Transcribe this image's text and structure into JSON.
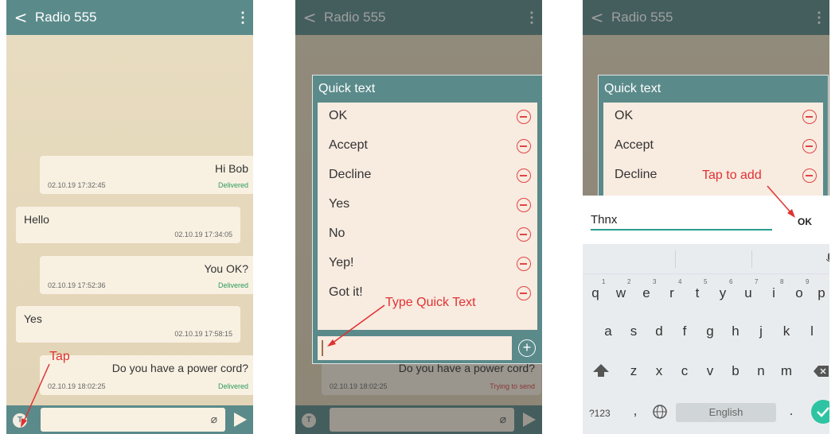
{
  "header": {
    "back": "<",
    "title": "Radio 555",
    "menu": "⋮"
  },
  "bar": {
    "qt_icon": "T",
    "clip": "⌀"
  },
  "messages": [
    {
      "dir": "out",
      "text": "Hi Bob",
      "time": "02.10.19 17:32:45",
      "status": "Delivered"
    },
    {
      "dir": "in",
      "text": "Hello",
      "time": "02.10.19 17:34:05",
      "status": ""
    },
    {
      "dir": "out",
      "text": "You OK?",
      "time": "02.10.19 17:52:36",
      "status": "Delivered"
    },
    {
      "dir": "in",
      "text": "Yes",
      "time": "02.10.19 17:58:15",
      "status": ""
    },
    {
      "dir": "out",
      "text": "Do you have a power cord?",
      "time": "02.10.19 18:02:25",
      "status": "Delivered"
    }
  ],
  "panel2": {
    "msg_text": "Do you have a power cord?",
    "msg_time": "02.10.19 18:02:25",
    "msg_status": "Trying to send"
  },
  "quick": {
    "title": "Quick text",
    "items": [
      "OK",
      "Accept",
      "Decline",
      "Yes",
      "No",
      "Yep!",
      "Got it!"
    ],
    "plus": "+"
  },
  "annotations": {
    "tap": "Tap",
    "type_quick": "Type Quick Text",
    "tap_add": "Tap to add"
  },
  "add": {
    "text": "Thnx",
    "ok": "OK"
  },
  "keyboard": {
    "row1": [
      "q",
      "w",
      "e",
      "r",
      "t",
      "y",
      "u",
      "i",
      "o",
      "p"
    ],
    "nums": [
      "1",
      "2",
      "3",
      "4",
      "5",
      "6",
      "7",
      "8",
      "9",
      "0"
    ],
    "row2": [
      "a",
      "s",
      "d",
      "f",
      "g",
      "h",
      "j",
      "k",
      "l"
    ],
    "row3": [
      "z",
      "x",
      "c",
      "v",
      "b",
      "n",
      "m"
    ],
    "mode": "?123",
    "comma": ",",
    "space": "English",
    "period": "."
  },
  "colors": {
    "accent": "#5b8a8a",
    "annotation": "#e03232"
  }
}
